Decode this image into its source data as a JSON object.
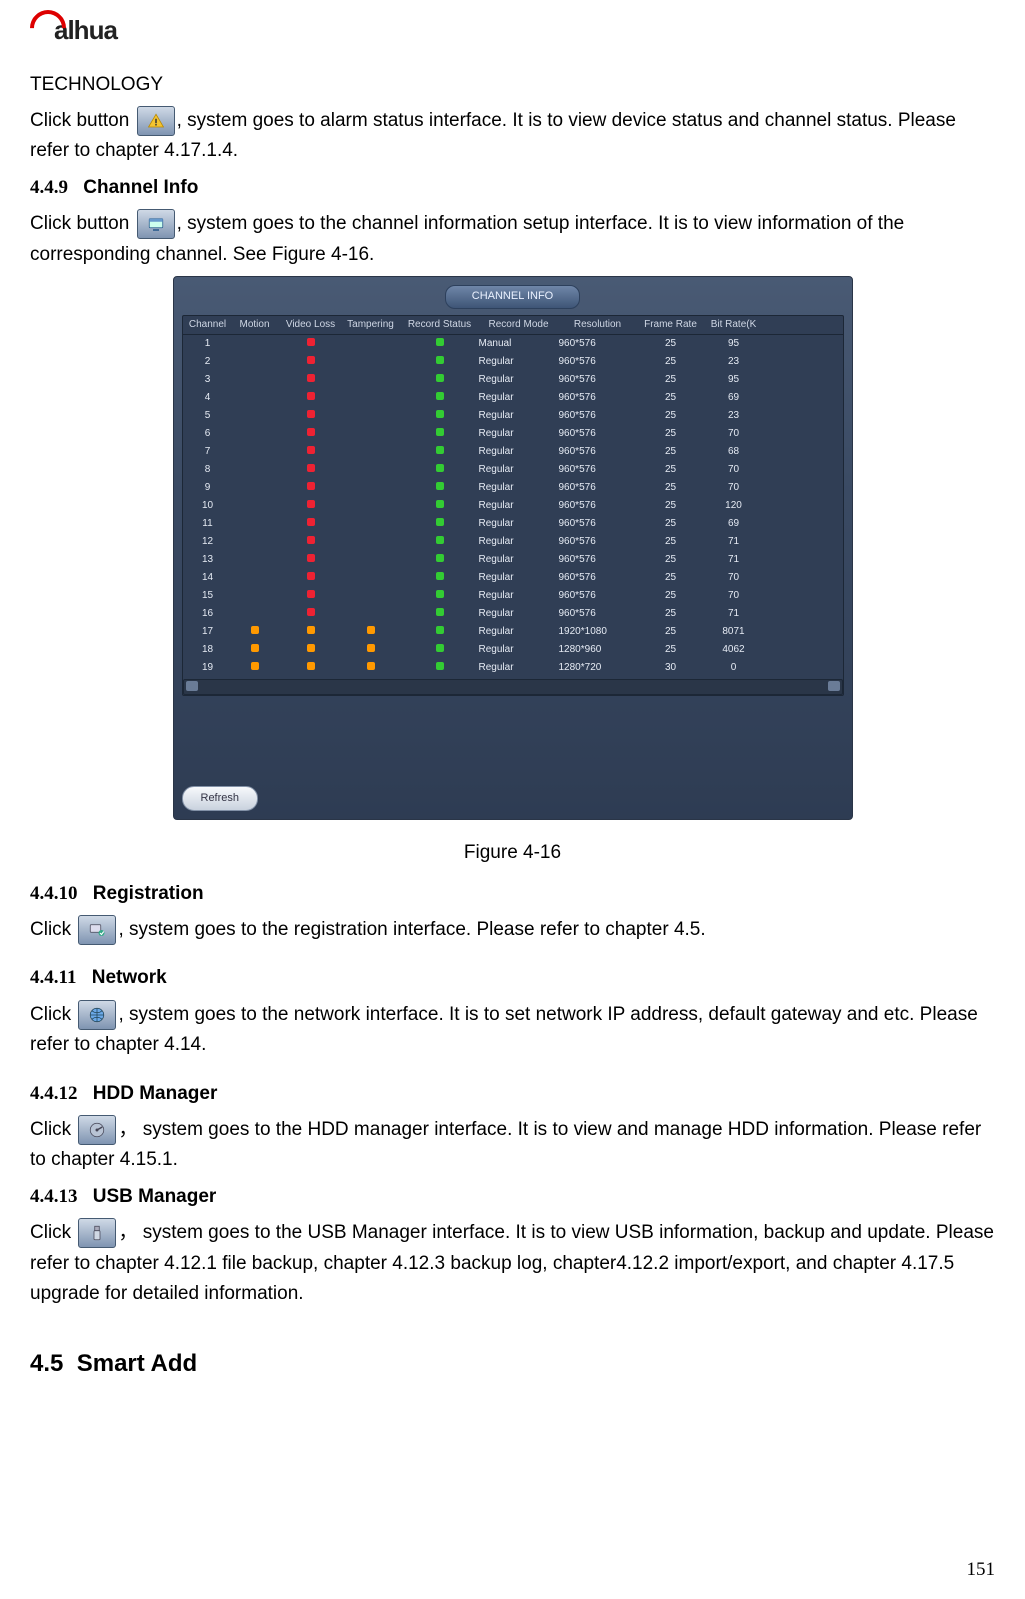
{
  "logo": {
    "brand": "alhua",
    "sub": "TECHNOLOGY"
  },
  "p1_a": "Click button",
  "p1_b": ", system goes to alarm status interface. It is to view device status and channel status. Please refer to chapter 4.17.1.4.",
  "s449": {
    "num": "4.4.9",
    "title": "Channel Info",
    "a": "Click button",
    "b": ", system goes to the channel information setup interface. It is to view information of the corresponding channel. See Figure 4-16."
  },
  "figure": {
    "title": "CHANNEL INFO",
    "caption": "Figure 4-16",
    "refresh": "Refresh",
    "headers": [
      "Channel",
      "Motion",
      "Video Loss",
      "Tampering",
      "Record Status",
      "Record Mode",
      "Resolution",
      "Frame Rate",
      "Bit Rate(K"
    ],
    "rows": [
      {
        "ch": "1",
        "m": "",
        "v": "red",
        "t": "",
        "rs": "green",
        "mode": "Manual",
        "res": "960*576",
        "fr": "25",
        "br": "95"
      },
      {
        "ch": "2",
        "m": "",
        "v": "red",
        "t": "",
        "rs": "green",
        "mode": "Regular",
        "res": "960*576",
        "fr": "25",
        "br": "23"
      },
      {
        "ch": "3",
        "m": "",
        "v": "red",
        "t": "",
        "rs": "green",
        "mode": "Regular",
        "res": "960*576",
        "fr": "25",
        "br": "95"
      },
      {
        "ch": "4",
        "m": "",
        "v": "red",
        "t": "",
        "rs": "green",
        "mode": "Regular",
        "res": "960*576",
        "fr": "25",
        "br": "69"
      },
      {
        "ch": "5",
        "m": "",
        "v": "red",
        "t": "",
        "rs": "green",
        "mode": "Regular",
        "res": "960*576",
        "fr": "25",
        "br": "23"
      },
      {
        "ch": "6",
        "m": "",
        "v": "red",
        "t": "",
        "rs": "green",
        "mode": "Regular",
        "res": "960*576",
        "fr": "25",
        "br": "70"
      },
      {
        "ch": "7",
        "m": "",
        "v": "red",
        "t": "",
        "rs": "green",
        "mode": "Regular",
        "res": "960*576",
        "fr": "25",
        "br": "68"
      },
      {
        "ch": "8",
        "m": "",
        "v": "red",
        "t": "",
        "rs": "green",
        "mode": "Regular",
        "res": "960*576",
        "fr": "25",
        "br": "70"
      },
      {
        "ch": "9",
        "m": "",
        "v": "red",
        "t": "",
        "rs": "green",
        "mode": "Regular",
        "res": "960*576",
        "fr": "25",
        "br": "70"
      },
      {
        "ch": "10",
        "m": "",
        "v": "red",
        "t": "",
        "rs": "green",
        "mode": "Regular",
        "res": "960*576",
        "fr": "25",
        "br": "120"
      },
      {
        "ch": "11",
        "m": "",
        "v": "red",
        "t": "",
        "rs": "green",
        "mode": "Regular",
        "res": "960*576",
        "fr": "25",
        "br": "69"
      },
      {
        "ch": "12",
        "m": "",
        "v": "red",
        "t": "",
        "rs": "green",
        "mode": "Regular",
        "res": "960*576",
        "fr": "25",
        "br": "71"
      },
      {
        "ch": "13",
        "m": "",
        "v": "red",
        "t": "",
        "rs": "green",
        "mode": "Regular",
        "res": "960*576",
        "fr": "25",
        "br": "71"
      },
      {
        "ch": "14",
        "m": "",
        "v": "red",
        "t": "",
        "rs": "green",
        "mode": "Regular",
        "res": "960*576",
        "fr": "25",
        "br": "70"
      },
      {
        "ch": "15",
        "m": "",
        "v": "red",
        "t": "",
        "rs": "green",
        "mode": "Regular",
        "res": "960*576",
        "fr": "25",
        "br": "70"
      },
      {
        "ch": "16",
        "m": "",
        "v": "red",
        "t": "",
        "rs": "green",
        "mode": "Regular",
        "res": "960*576",
        "fr": "25",
        "br": "71"
      },
      {
        "ch": "17",
        "m": "ora",
        "v": "ora",
        "t": "ora",
        "rs": "green",
        "mode": "Regular",
        "res": "1920*1080",
        "fr": "25",
        "br": "8071"
      },
      {
        "ch": "18",
        "m": "ora",
        "v": "ora",
        "t": "ora",
        "rs": "green",
        "mode": "Regular",
        "res": "1280*960",
        "fr": "25",
        "br": "4062"
      },
      {
        "ch": "19",
        "m": "ora",
        "v": "ora",
        "t": "ora",
        "rs": "green",
        "mode": "Regular",
        "res": "1280*720",
        "fr": "30",
        "br": "0"
      }
    ]
  },
  "s4410": {
    "num": "4.4.10",
    "title": "Registration",
    "a": "Click",
    "b": ", system goes to the registration interface. Please refer to chapter 4.5."
  },
  "s4411": {
    "num": "4.4.11",
    "title": "Network",
    "a": "Click",
    "b": ", system goes to the network interface. It is to set network IP address, default gateway and etc. Please refer to chapter 4.14."
  },
  "s4412": {
    "num": "4.4.12",
    "title": "HDD Manager",
    "a": "Click ",
    "b": "，  system goes to the HDD manager interface. It is to view and manage HDD information. Please refer to chapter 4.15.1."
  },
  "s4413": {
    "num": "4.4.13",
    "title": "USB Manager",
    "a": "Click ",
    "b": "， system goes to the USB Manager interface. It is to view USB information, backup and update. Please refer to chapter 4.12.1 file backup, chapter 4.12.3 backup log, chapter4.12.2 import/export, and chapter 4.17.5 upgrade for detailed information."
  },
  "s45": {
    "num": "4.5",
    "title": "Smart Add"
  },
  "page_number": "151"
}
